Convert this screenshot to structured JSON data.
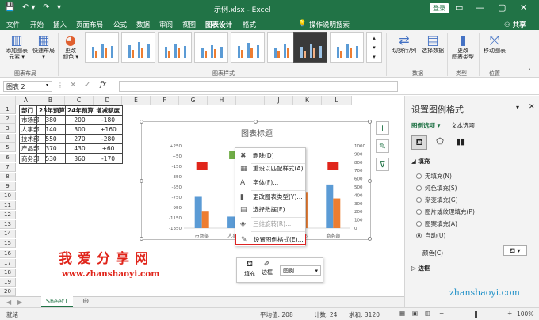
{
  "window": {
    "title": "示例.xlsx  -  Excel",
    "login": "登录"
  },
  "menu": [
    "文件",
    "开始",
    "插入",
    "页面布局",
    "公式",
    "数据",
    "审阅",
    "视图",
    "图表设计",
    "格式"
  ],
  "menu_active": "图表设计",
  "tell_me": "操作说明搜索",
  "share": "共享",
  "ribbon": {
    "add_element": "添加图表\n元素 ▾",
    "quick_layout": "快速布局\n▾",
    "change_colors": "更改\n颜色 ▾",
    "switch_rowcol": "切换行/列",
    "select_data": "选择数据",
    "change_type": "更改\n图表类型",
    "move_chart": "移动图表",
    "groups": [
      "图表布局",
      "图表样式",
      "数据",
      "类型",
      "位置"
    ]
  },
  "name_box": "图表 2",
  "fx": "fx",
  "columns": [
    "A",
    "B",
    "C",
    "D",
    "E",
    "F",
    "G",
    "H",
    "I",
    "J",
    "K",
    "L"
  ],
  "rows": [
    "1",
    "2",
    "3",
    "4",
    "5",
    "6",
    "7",
    "8",
    "9",
    "10",
    "11",
    "12",
    "13",
    "14",
    "15",
    "16",
    "17",
    "18",
    "19",
    "20"
  ],
  "table": {
    "headers": [
      "部门",
      "23年预算",
      "24年预算",
      "增减额度"
    ],
    "rows": [
      [
        "市场部",
        "380",
        "200",
        "-180"
      ],
      [
        "人事部",
        "140",
        "300",
        "+160"
      ],
      [
        "技术部",
        "550",
        "270",
        "-280"
      ],
      [
        "产品部",
        "370",
        "430",
        "+60"
      ],
      [
        "商务部",
        "530",
        "360",
        "-170"
      ]
    ]
  },
  "chart_data": {
    "type": "bar",
    "title": "图表标题",
    "categories": [
      "市场部",
      "人事部",
      "技术部",
      "产品部",
      "商务部"
    ],
    "left_axis_ticks": [
      "+250",
      "+50",
      "-150",
      "-350",
      "-550",
      "-750",
      "-950",
      "-1150",
      "-1350"
    ],
    "right_axis_ticks": [
      "1000",
      "900",
      "800",
      "700",
      "600",
      "500",
      "400",
      "300",
      "200",
      "100",
      "0"
    ],
    "series": [
      {
        "name": "23年预算",
        "values": [
          380,
          140,
          550,
          370,
          530
        ],
        "color": "#5b9bd5"
      },
      {
        "name": "24年预算",
        "values": [
          200,
          300,
          270,
          430,
          360
        ],
        "color": "#ed7d31"
      },
      {
        "name": "增减额度",
        "values": [
          -180,
          160,
          -280,
          60,
          -170
        ]
      }
    ],
    "ylim_right": [
      0,
      1000
    ],
    "legend": "bottom",
    "legend_entries": [
      "增减额度",
      "23年预算",
      "24年预算"
    ]
  },
  "context_menu": [
    {
      "label": "删除(D)",
      "icon": "delete-icon",
      "glyph": "✖",
      "disabled": false
    },
    {
      "label": "重设以匹配样式(A)",
      "icon": "reset-style-icon",
      "glyph": "▦",
      "disabled": false
    },
    {
      "label": "字体(F)...",
      "icon": "font-icon",
      "glyph": "A",
      "disabled": false
    },
    {
      "label": "更改图表类型(Y)...",
      "icon": "chart-type-icon",
      "glyph": "▮",
      "disabled": false
    },
    {
      "label": "选择数据(E)...",
      "icon": "select-data-icon",
      "glyph": "▤",
      "disabled": false
    },
    {
      "label": "三维旋转(R)...",
      "icon": "rotate-3d-icon",
      "glyph": "◈",
      "disabled": true
    },
    {
      "label": "设置图例格式(E)...",
      "icon": "format-legend-icon",
      "glyph": "✎",
      "disabled": false
    }
  ],
  "mini_toolbar": {
    "fill": "填充",
    "outline": "边框",
    "dropdown": "图例"
  },
  "pane": {
    "title": "设置图例格式",
    "tab1": "图例选项",
    "tab2": "文本选项",
    "section_fill": "填充",
    "fill_options": [
      "无填充(N)",
      "纯色填充(S)",
      "渐变填充(G)",
      "图片或纹理填充(P)",
      "图案填充(A)",
      "自动(U)"
    ],
    "fill_selected": 5,
    "color_label": "颜色(C)",
    "section_border": "边框"
  },
  "sheet_tab": "Sheet1",
  "status": {
    "ready": "就绪",
    "avg": "平均值: 208",
    "count": "计数: 24",
    "sum": "求和: 3120",
    "zoom": "100%"
  },
  "watermark": {
    "cn": "我爱分享网",
    "url": "www.zhanshaoyi.com",
    "url2": "zhanshaoyi.com"
  },
  "colors": {
    "brand": "#217346",
    "red_box": "#e0251b",
    "green_box": "#70ad47"
  }
}
